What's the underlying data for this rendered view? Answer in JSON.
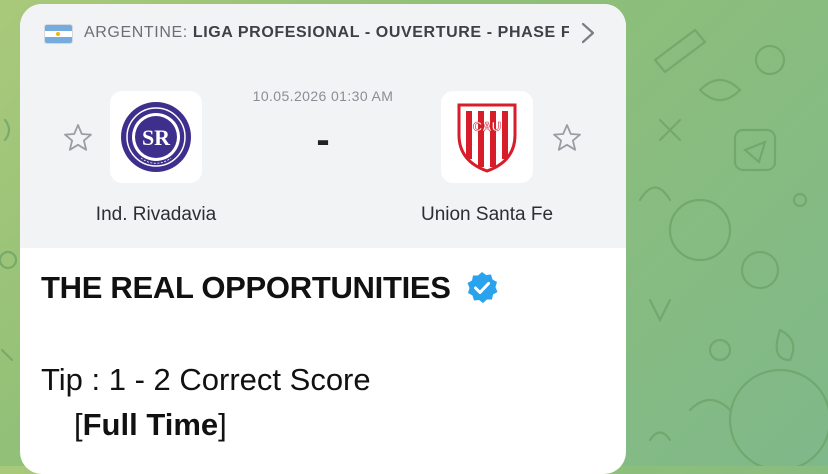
{
  "league": {
    "country": "ARGENTINE:",
    "name": "LIGA PROFESIONAL - OUVERTURE - PHASE FI..."
  },
  "match": {
    "datetime": "10.05.2026 01:30 AM",
    "score": "-",
    "home_team": "Ind. Rivadavia",
    "away_team": "Union Santa Fe",
    "home_logo_text": "INDEPENDIENTE RIVADAVIA MENDOZA",
    "home_logo_initials": "SR",
    "away_logo_initials": "CAU"
  },
  "post": {
    "headline": "THE REAL OPPORTUNITIES",
    "tip": "Tip : 1 - 2 Correct Score",
    "bracket_open": "[",
    "full_time": "Full Time",
    "bracket_close": "]"
  },
  "colors": {
    "home_primary": "#3f2f8c",
    "away_primary": "#d71d2a",
    "verified": "#2aa3ef"
  }
}
